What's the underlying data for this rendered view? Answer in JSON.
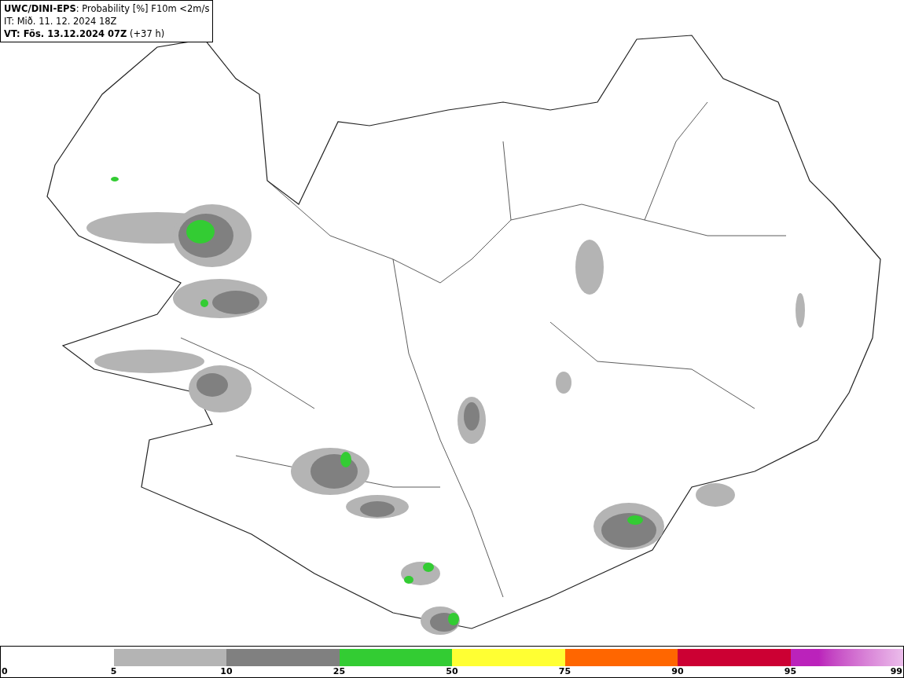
{
  "header": {
    "title": "**UWC/DINI-EPS**: Probability [%] F10m <2m/s",
    "init_time": "IT: Mið. 11. 12. 2024 18Z",
    "valid_time": "**VT: Fös. 13.12.2024 07Z** (+37 h)"
  },
  "legend": {
    "segments": [
      {
        "kind": "solid",
        "color": "#ffffff"
      },
      {
        "kind": "solid",
        "color": "#b4b4b4"
      },
      {
        "kind": "solid",
        "color": "#808080"
      },
      {
        "kind": "solid",
        "color": "#33cc33"
      },
      {
        "kind": "solid",
        "color": "#ffff33"
      },
      {
        "kind": "solid",
        "color": "#ff6600"
      },
      {
        "kind": "solid",
        "color": "#cc0033"
      },
      {
        "kind": "gradient",
        "color": "#bb22bb"
      }
    ],
    "labels": [
      "0",
      "5",
      "10",
      "25",
      "50",
      "75",
      "90",
      "95",
      "99"
    ]
  }
}
